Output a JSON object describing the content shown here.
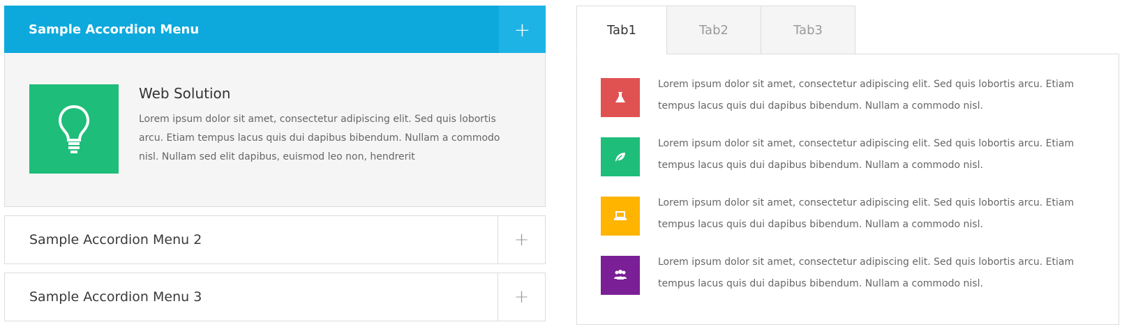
{
  "accordion": {
    "items": [
      {
        "title": "Sample Accordion Menu",
        "toggle": "+",
        "content": {
          "icon": "lightbulb-icon",
          "heading": "Web Solution",
          "text": "Lorem ipsum dolor sit amet, consectetur adipiscing elit. Sed quis lobortis arcu. Etiam tempus lacus quis dui dapibus bibendum. Nullam a commodo nisl. Nullam sed elit dapibus, euismod leo non, hendrerit"
        }
      },
      {
        "title": "Sample Accordion Menu 2",
        "toggle": "+"
      },
      {
        "title": "Sample Accordion Menu 3",
        "toggle": "+"
      }
    ]
  },
  "tabs": {
    "labels": [
      "Tab1",
      "Tab2",
      "Tab3"
    ],
    "panel_rows": [
      {
        "icon": "flask-icon",
        "color": "#e05252",
        "text": "Lorem ipsum dolor sit amet, consectetur adipiscing elit. Sed quis lobortis arcu. Etiam tempus lacus quis dui dapibus bibendum. Nullam a commodo nisl."
      },
      {
        "icon": "leaf-icon",
        "color": "#1ebd7a",
        "text": "Lorem ipsum dolor sit amet, consectetur adipiscing elit. Sed quis lobortis arcu. Etiam tempus lacus quis dui dapibus bibendum. Nullam a commodo nisl."
      },
      {
        "icon": "laptop-icon",
        "color": "#ffb400",
        "text": "Lorem ipsum dolor sit amet, consectetur adipiscing elit. Sed quis lobortis arcu. Etiam tempus lacus quis dui dapibus bibendum. Nullam a commodo nisl."
      },
      {
        "icon": "users-icon",
        "color": "#7b1f96",
        "text": "Lorem ipsum dolor sit amet, consectetur adipiscing elit. Sed quis lobortis arcu. Etiam tempus lacus quis dui dapibus bibendum. Nullam a commodo nisl."
      }
    ]
  },
  "colors": {
    "accent": "#0ea9dc",
    "accent_light": "#1db4e5",
    "feature_icon_bg": "#1ebd7a"
  }
}
